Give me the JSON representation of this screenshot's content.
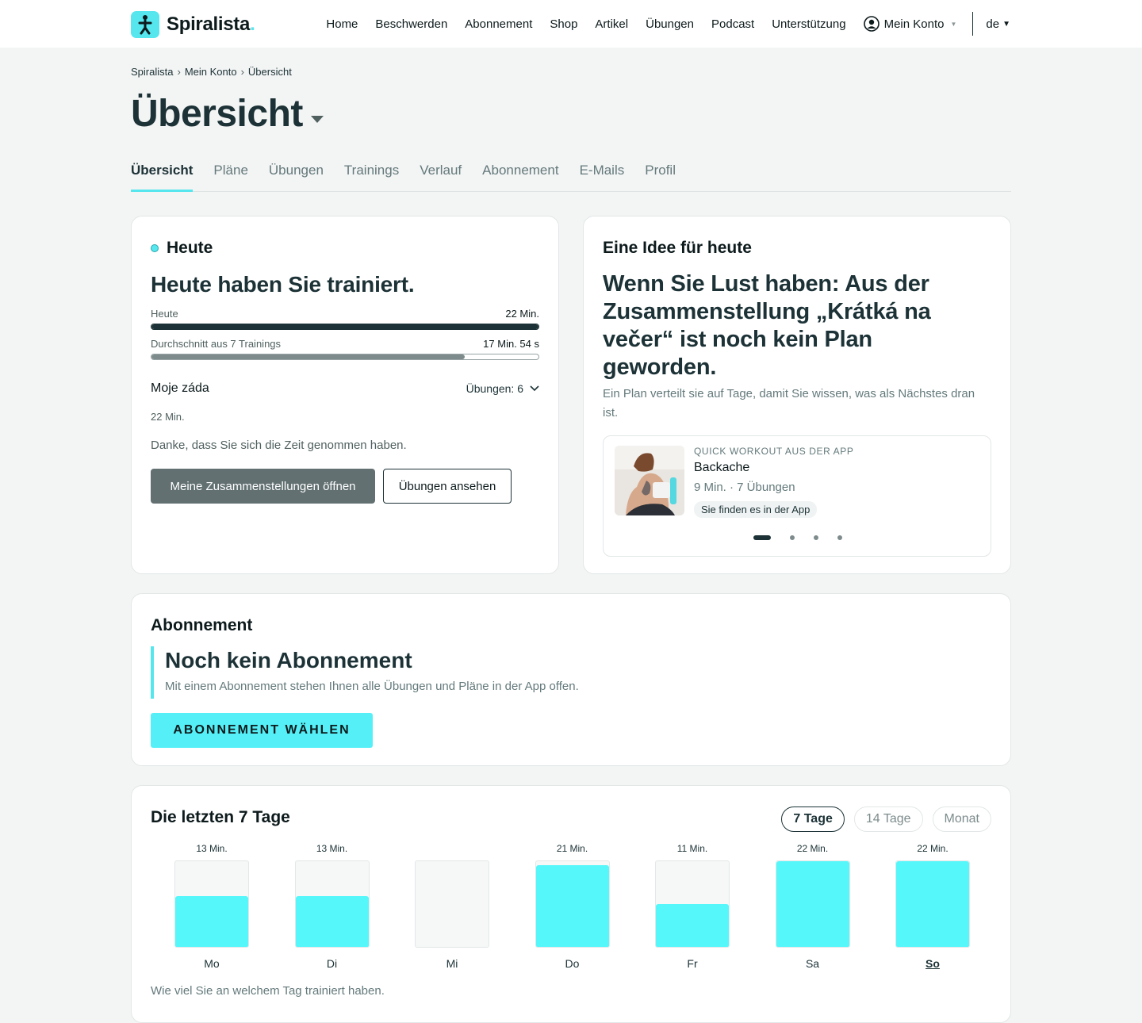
{
  "brand": {
    "name": "Spiralista",
    "dot": ".",
    "accent": "#55e6ee"
  },
  "nav": {
    "items": [
      "Home",
      "Beschwerden",
      "Abonnement",
      "Shop",
      "Artikel",
      "Übungen",
      "Podcast",
      "Unterstützung"
    ],
    "account": "Mein Konto",
    "lang": "de"
  },
  "breadcrumb": [
    "Spiralista",
    "Mein Konto",
    "Übersicht"
  ],
  "page": {
    "title": "Übersicht"
  },
  "tabs": [
    "Übersicht",
    "Pläne",
    "Übungen",
    "Trainings",
    "Verlauf",
    "Abonnement",
    "E-Mails",
    "Profil"
  ],
  "today": {
    "heading": "Heute",
    "message": "Heute haben Sie trainiert.",
    "today_bar": {
      "label": "Heute",
      "value": "22 Min.",
      "fraction": 1.0
    },
    "avg_bar": {
      "label": "Durchschnitt aus 7 Trainings",
      "value": "17 Min. 54 s",
      "fraction": 0.81
    },
    "plan_name": "Moje záda",
    "plan_count": "Übungen: 6",
    "plan_duration": "22 Min.",
    "thanks": "Danke, dass Sie sich die Zeit genommen haben.",
    "btn_primary": "Meine Zusammenstellungen öffnen",
    "btn_secondary": "Übungen ansehen"
  },
  "idea": {
    "heading": "Eine Idee für heute",
    "title": "Wenn Sie Lust haben: Aus der Zusammenstellung „Krátká na večer“ ist noch kein Plan geworden.",
    "desc": "Ein Plan verteilt sie auf Tage, damit Sie wissen, was als Nächstes dran ist.",
    "workout": {
      "kicker": "QUICK WORKOUT AUS DER APP",
      "name": "Backache",
      "meta": "9 Min. · 7 Übungen",
      "badge": "Sie finden es in der App"
    },
    "pages": 4,
    "active_page": 1
  },
  "subscription": {
    "heading": "Abonnement",
    "title": "Noch kein Abonnement",
    "desc": "Mit einem Abonnement stehen Ihnen alle Übungen und Pläne in der App offen.",
    "button": "ABONNEMENT WÄHLEN"
  },
  "week": {
    "heading": "Die letzten 7 Tage",
    "ranges": [
      "7 Tage",
      "14 Tage",
      "Monat"
    ],
    "active_range": "7 Tage",
    "note": "Wie viel Sie an welchem Tag trainiert haben."
  },
  "chart_data": {
    "type": "bar",
    "categories": [
      "Mo",
      "Di",
      "Mi",
      "Do",
      "Fr",
      "Sa",
      "So"
    ],
    "values": [
      13,
      13,
      0,
      21,
      11,
      22,
      22
    ],
    "labels": [
      "13 Min.",
      "13 Min.",
      "",
      "21 Min.",
      "11 Min.",
      "22 Min.",
      "22 Min."
    ],
    "ylim": [
      0,
      22
    ],
    "highlight": "So",
    "color": "#55f7fb"
  }
}
